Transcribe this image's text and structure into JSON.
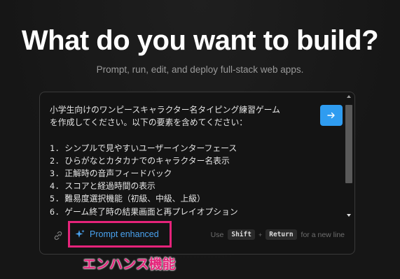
{
  "header": {
    "title": "What do you want to build?",
    "subtitle": "Prompt, run, edit, and deploy full-stack web apps."
  },
  "prompt": {
    "text": "小学生向けのワンピースキャラクター名タイピング練習ゲーム\nを作成してください。以下の要素を含めてください：\n\n1. シンプルで見やすいユーザーインターフェース\n2. ひらがなとカタカナでのキャラクター名表示\n3. 正解時の音声フィードバック\n4. スコアと経過時間の表示\n5. 難易度選択機能（初級、中級、上級）\n6. ゲーム終了時の結果画面と再プレイオプション",
    "send_icon": "arrow-right-icon"
  },
  "toolbar": {
    "link_icon": "link-icon",
    "enhanced_icon": "sparkle-icon",
    "enhanced_label": "Prompt enhanced",
    "hint_use": "Use",
    "hint_key1": "Shift",
    "hint_plus": "+",
    "hint_key2": "Return",
    "hint_suffix": "for a new line"
  },
  "annotation": {
    "label": "エンハンス機能",
    "color": "#e5237a"
  },
  "colors": {
    "accent": "#2f9cf0",
    "highlight": "#e5237a",
    "background": "#181818"
  }
}
